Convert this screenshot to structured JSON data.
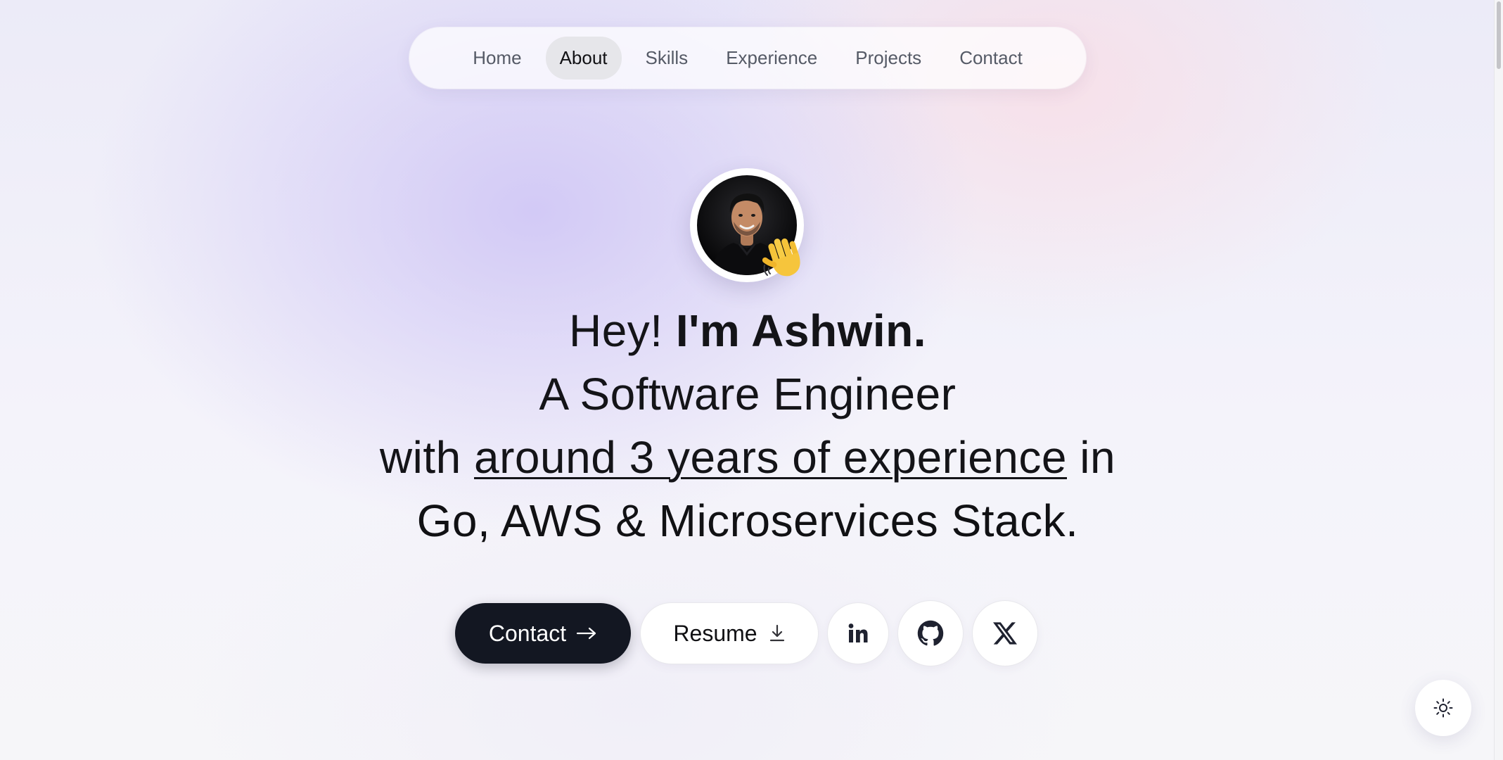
{
  "nav": {
    "items": [
      {
        "label": "Home",
        "active": false
      },
      {
        "label": "About",
        "active": true
      },
      {
        "label": "Skills",
        "active": false
      },
      {
        "label": "Experience",
        "active": false
      },
      {
        "label": "Projects",
        "active": false
      },
      {
        "label": "Contact",
        "active": false
      }
    ]
  },
  "hero": {
    "greeting": "Hey!",
    "name": "I'm Ashwin.",
    "role": "A Software Engineer",
    "with_prefix": "with",
    "experience": "around 3 years of experience",
    "in_word": "in",
    "stack": "Go, AWS & Microservices Stack.",
    "avatar_icon": "profile-photo",
    "wave_icon": "waving-hand-icon"
  },
  "actions": {
    "contact_label": "Contact",
    "contact_icon": "arrow-right-icon",
    "resume_label": "Resume",
    "resume_icon": "download-icon",
    "social": [
      "linkedin-icon",
      "github-icon",
      "x-icon"
    ]
  },
  "theme_toggle": {
    "icon": "sun-icon"
  },
  "colors": {
    "primary_button": "#131722",
    "active_nav": "#e6e6ea",
    "text": "#111114"
  }
}
